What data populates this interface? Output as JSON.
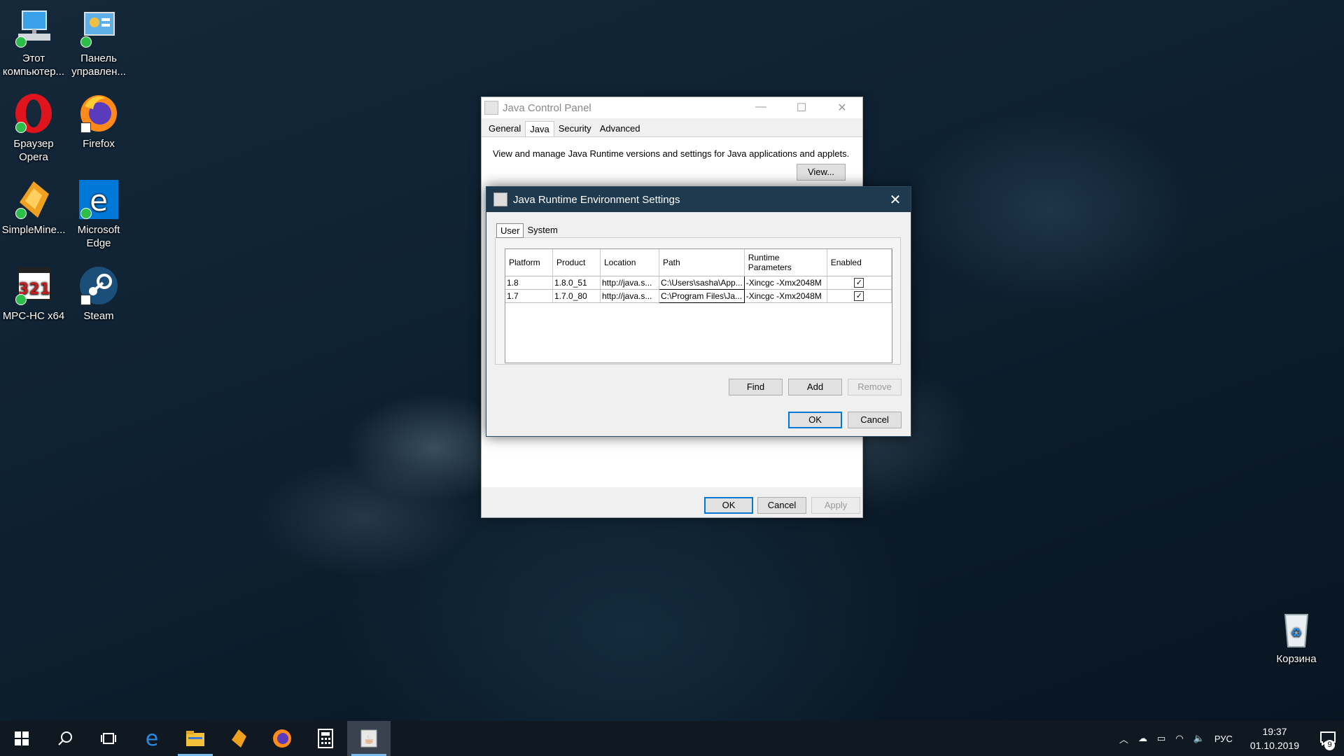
{
  "desktop": {
    "icons": [
      {
        "label": "Этот компьютер...",
        "icon": "computer-icon"
      },
      {
        "label": "Панель управлен...",
        "icon": "control-panel-icon"
      },
      {
        "label": "Браузер Opera",
        "icon": "opera-icon"
      },
      {
        "label": "Firefox",
        "icon": "firefox-icon"
      },
      {
        "label": "SimpleMine...",
        "icon": "simpleminer-icon"
      },
      {
        "label": "Microsoft Edge",
        "icon": "edge-icon"
      },
      {
        "label": "MPC-HC x64",
        "icon": "mpc-hc-icon"
      },
      {
        "label": "Steam",
        "icon": "steam-icon"
      },
      {
        "label": "Корзина",
        "icon": "recycle-bin-icon"
      }
    ]
  },
  "jcp": {
    "title": "Java Control Panel",
    "tabs": [
      "General",
      "Java",
      "Security",
      "Advanced"
    ],
    "description": "View and manage Java Runtime versions and settings for Java applications and applets.",
    "view_button": "View...",
    "ok": "OK",
    "cancel": "Cancel",
    "apply": "Apply"
  },
  "jre": {
    "title": "Java Runtime Environment Settings",
    "tabs": [
      "User",
      "System"
    ],
    "columns": [
      "Platform",
      "Product",
      "Location",
      "Path",
      "Runtime Parameters",
      "Enabled"
    ],
    "rows": [
      {
        "platform": "1.8",
        "product": "1.8.0_51",
        "location": "http://java.s...",
        "path": "C:\\Users\\sasha\\App...",
        "params": "-Xincgc -Xmx2048M",
        "enabled": true
      },
      {
        "platform": "1.7",
        "product": "1.7.0_80",
        "location": "http://java.s...",
        "path": "C:\\Program Files\\Ja...",
        "params": "-Xincgc -Xmx2048M",
        "enabled": true
      }
    ],
    "find": "Find",
    "add": "Add",
    "remove": "Remove",
    "ok": "OK",
    "cancel": "Cancel"
  },
  "taskbar": {
    "lang": "РУС",
    "time": "19:37",
    "date": "01.10.2019",
    "notifications": "9"
  }
}
